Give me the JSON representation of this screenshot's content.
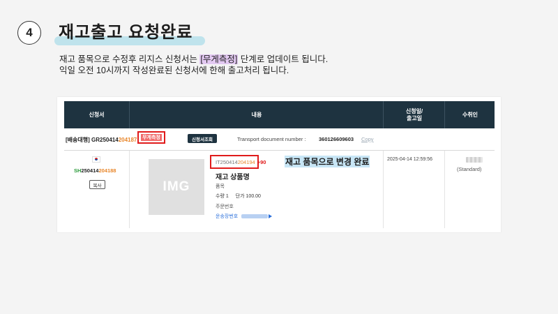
{
  "slide": {
    "step_number": "4",
    "title": "재고출고 요청완료",
    "description_line1_prefix": "재고 품목으로 수정후 리지스 신청서는 ",
    "description_line1_highlight": "[무게측정]",
    "description_line1_suffix": " 단계로 업데이트 됩니다.",
    "description_line2": "익일 오전 10시까지 작성완료된 신청서에 한해 출고처리 됩니다."
  },
  "table": {
    "headers": {
      "application": "신청서",
      "content": "내용",
      "date_line1": "신청일/",
      "date_line2": "출고일",
      "recipient": "수취인"
    }
  },
  "order": {
    "prefix": "[배송대행] GR250414",
    "suffix": "204187",
    "status_badge": "무게측정",
    "inquiry_button": "신청서조회",
    "transport_label": "Transport document number :",
    "transport_number": "360126609603",
    "copy_link": "Copy"
  },
  "item": {
    "sub_id_prefix": "SH",
    "sub_id_num": "250414",
    "sub_id_suffix": "204188",
    "copy_button": "복사",
    "image_placeholder": "IMG",
    "item_id_prefix": "IT250414",
    "item_id_suffix": "204194",
    "item_id_delta": "+90",
    "changed_note": "재고 품목으로 변경 완료",
    "name": "재고 상품명",
    "product_label": "품목",
    "quantity": "수량 1",
    "unit_price": "단가 100.00",
    "order_number_label": "주문번호",
    "tracking_label": "운송장번호",
    "datetime": "2025-04-14 12:59:56",
    "recipient_type": "(Standard)"
  },
  "colors": {
    "header_bg": "#1e3340",
    "highlight_red": "#e01b1b",
    "badge_red": "#f06b6b",
    "accent_orange": "#e8862a",
    "title_underline": "#bfe3ec",
    "highlight_purple": "#e3c9f2",
    "note_highlight": "#c8e6f6"
  }
}
